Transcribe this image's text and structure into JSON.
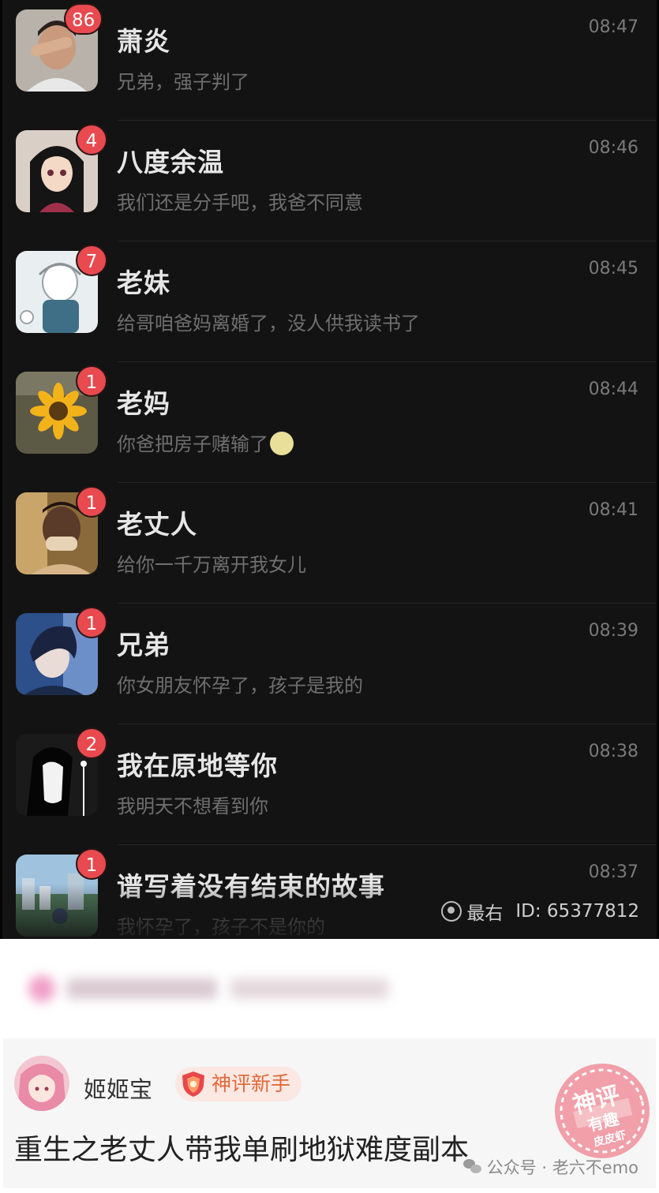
{
  "chats": [
    {
      "name": "萧炎",
      "preview": "兄弟，强子判了",
      "time": "08:47",
      "badge": "86",
      "avatar": "man-hand-face-avatar",
      "has_emoji": false
    },
    {
      "name": "八度余温",
      "preview": "我们还是分手吧，我爸不同意",
      "time": "08:46",
      "badge": "4",
      "avatar": "anime-girl-black-hair-avatar",
      "has_emoji": false
    },
    {
      "name": "老妹",
      "preview": "给哥咱爸妈离婚了，没人供我读书了",
      "time": "08:45",
      "badge": "7",
      "avatar": "sketch-girl-avatar",
      "has_emoji": false
    },
    {
      "name": "老妈",
      "preview": "你爸把房子赌输了",
      "time": "08:44",
      "badge": "1",
      "avatar": "sunflower-avatar",
      "has_emoji": true
    },
    {
      "name": "老丈人",
      "preview": "给你一千万离开我女儿",
      "time": "08:41",
      "badge": "1",
      "avatar": "crying-man-avatar",
      "has_emoji": false
    },
    {
      "name": "兄弟",
      "preview": "你女朋友怀孕了，孩子是我的",
      "time": "08:39",
      "badge": "1",
      "avatar": "anime-boy-blue-avatar",
      "has_emoji": false
    },
    {
      "name": "我在原地等你",
      "preview": "我明天不想看到你",
      "time": "08:38",
      "badge": "2",
      "avatar": "monochrome-girl-avatar",
      "has_emoji": false
    },
    {
      "name": "谱写着没有结束的故事",
      "preview": "我怀孕了，孩子不是你的",
      "time": "08:37",
      "badge": "1",
      "avatar": "city-scene-avatar",
      "has_emoji": false
    }
  ],
  "watermark": {
    "app": "最右",
    "id_text": "ID: 65377812"
  },
  "comment": {
    "username": "姬姬宝",
    "honor": "神评新手",
    "text": "重生之老丈人带我单刷地狱难度副本",
    "stamp": {
      "line1": "神评",
      "line2": "有趣",
      "line3": "皮皮虾"
    }
  },
  "footer": {
    "source": "公众号 · 老六不emo"
  },
  "colors": {
    "badge": "#e84a4f",
    "chat_bg": "#131313",
    "honor_text": "#e06a3a",
    "stamp": "#f08a96"
  }
}
